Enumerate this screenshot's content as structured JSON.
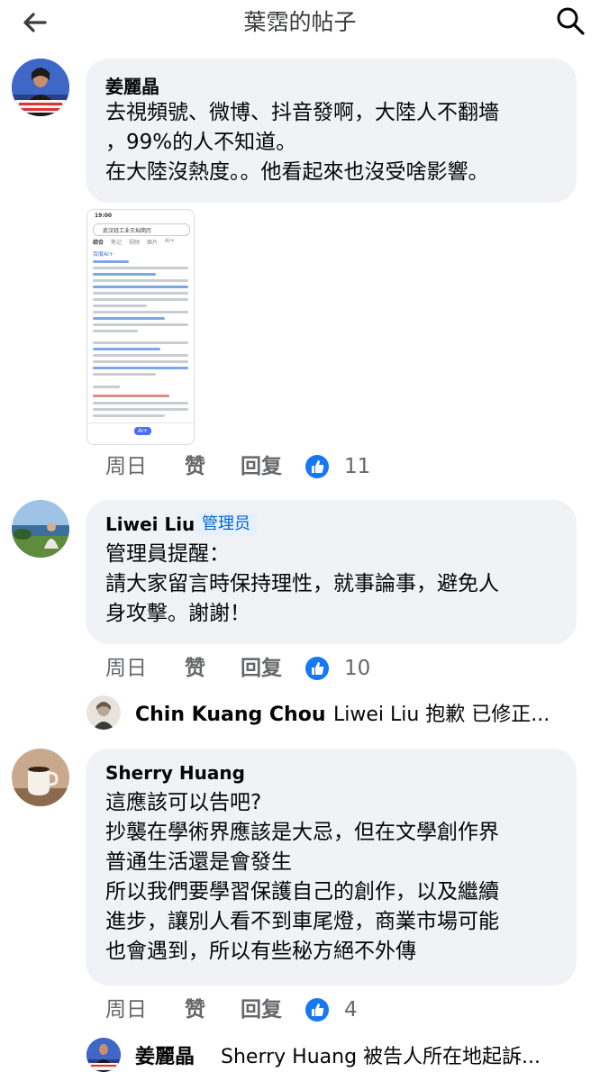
{
  "header": {
    "title": "葉霑的帖子",
    "back_icon": "arrow-left-icon",
    "search_icon": "search-icon"
  },
  "accent": "#1877f2",
  "comments": [
    {
      "author": "姜麗晶",
      "lines": [
        "去視頻號、微博、抖音發啊，大陸人不翻墻",
        "，99%的人不知道。",
        "在大陸沒熱度。。他看起來也沒受啥影響。"
      ],
      "image": {
        "status_time": "19:00",
        "search_query": "武汉轻工业王灿简历",
        "tabs": [
          "综合",
          "笔记",
          "视频",
          "图片",
          "AI+"
        ],
        "ai_label": "百度AI+",
        "bottom_ai": "AI+"
      },
      "time": "周日",
      "like_label": "赞",
      "reply_label": "回复",
      "likes": "11"
    },
    {
      "author": "Liwei Liu",
      "badge": "管理员",
      "lines": [
        "管理員提醒：",
        "請大家留言時保持理性，就事論事，避免人",
        "身攻擊。謝謝！"
      ],
      "time": "周日",
      "like_label": "赞",
      "reply_label": "回复",
      "likes": "10",
      "reply": {
        "author": "Chin Kuang Chou",
        "text": "Liwei Liu 抱歉 已修正..."
      }
    },
    {
      "author": "Sherry Huang",
      "lines": [
        "這應該可以告吧?",
        "抄襲在學術界應該是大忌，但在文學創作界",
        "普通生活還是會發生",
        "所以我們要學習保護自己的創作，以及繼續",
        "進步，讓別人看不到車尾燈，商業市場可能",
        "也會遇到，所以有些秘方絕不外傳"
      ],
      "time": "周日",
      "like_label": "赞",
      "reply_label": "回复",
      "likes": "4",
      "reply": {
        "author": "姜麗晶",
        "text": "Sherry Huang 被告人所在地起訴..."
      }
    }
  ]
}
